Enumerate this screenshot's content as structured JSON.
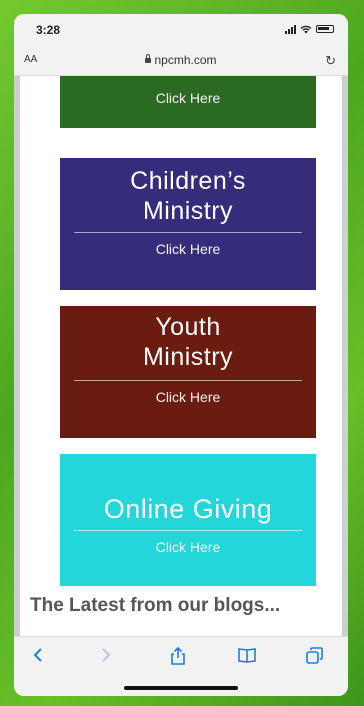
{
  "status": {
    "time": "3:28"
  },
  "browser": {
    "text_size": "AA",
    "url": "npcmh.com"
  },
  "tiles": [
    {
      "title_lines": [],
      "link": "Click Here",
      "color": "#2a6a22"
    },
    {
      "title_lines": [
        "Children’s",
        "Ministry"
      ],
      "link": "Click Here",
      "color": "#352d7c"
    },
    {
      "title_lines": [
        "Youth",
        "Ministry"
      ],
      "link": "Click Here",
      "color": "#6b1c10"
    },
    {
      "title_lines": [
        "Online Giving"
      ],
      "link": "Click Here",
      "color": "#22d6d9"
    }
  ],
  "blog": {
    "heading": "The Latest from our blogs..."
  },
  "toolbar": {
    "icons": [
      "back-icon",
      "forward-icon",
      "share-icon",
      "bookmarks-icon",
      "tabs-icon"
    ]
  },
  "colors": {
    "accent": "#1e7de3",
    "frame": "#5fb827"
  }
}
